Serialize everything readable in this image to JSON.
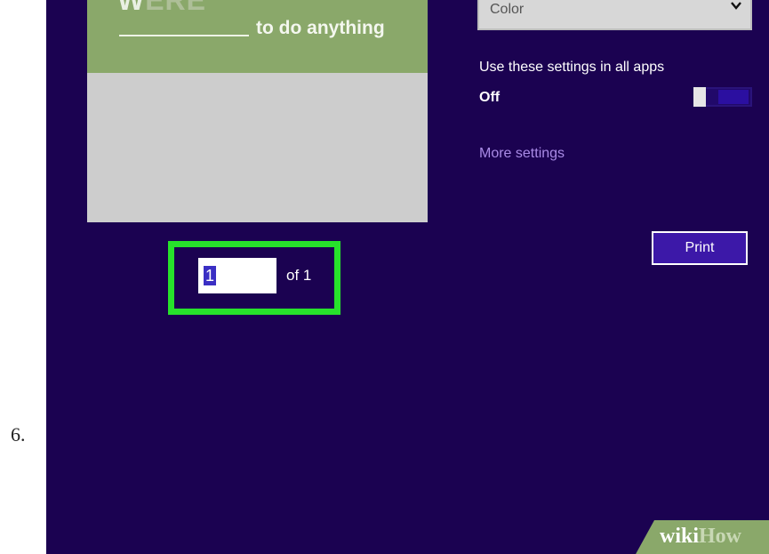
{
  "step": {
    "number": "6."
  },
  "preview": {
    "logo_part_a": "W",
    "logo_part_b": "ERE",
    "tagline": "to do anything"
  },
  "pager": {
    "current_page": "1",
    "of_label": "of 1"
  },
  "settings": {
    "color_mode": "Color",
    "all_apps_label": "Use these settings in all apps",
    "all_apps_state": "Off",
    "more_settings_link": "More settings",
    "print_button": "Print"
  },
  "watermark": {
    "part1": "wiki",
    "part2": "How"
  },
  "colors": {
    "screen_bg": "#1b0251",
    "highlight": "#27e22b",
    "banner": "#8aa86a",
    "link": "#a98be6"
  }
}
